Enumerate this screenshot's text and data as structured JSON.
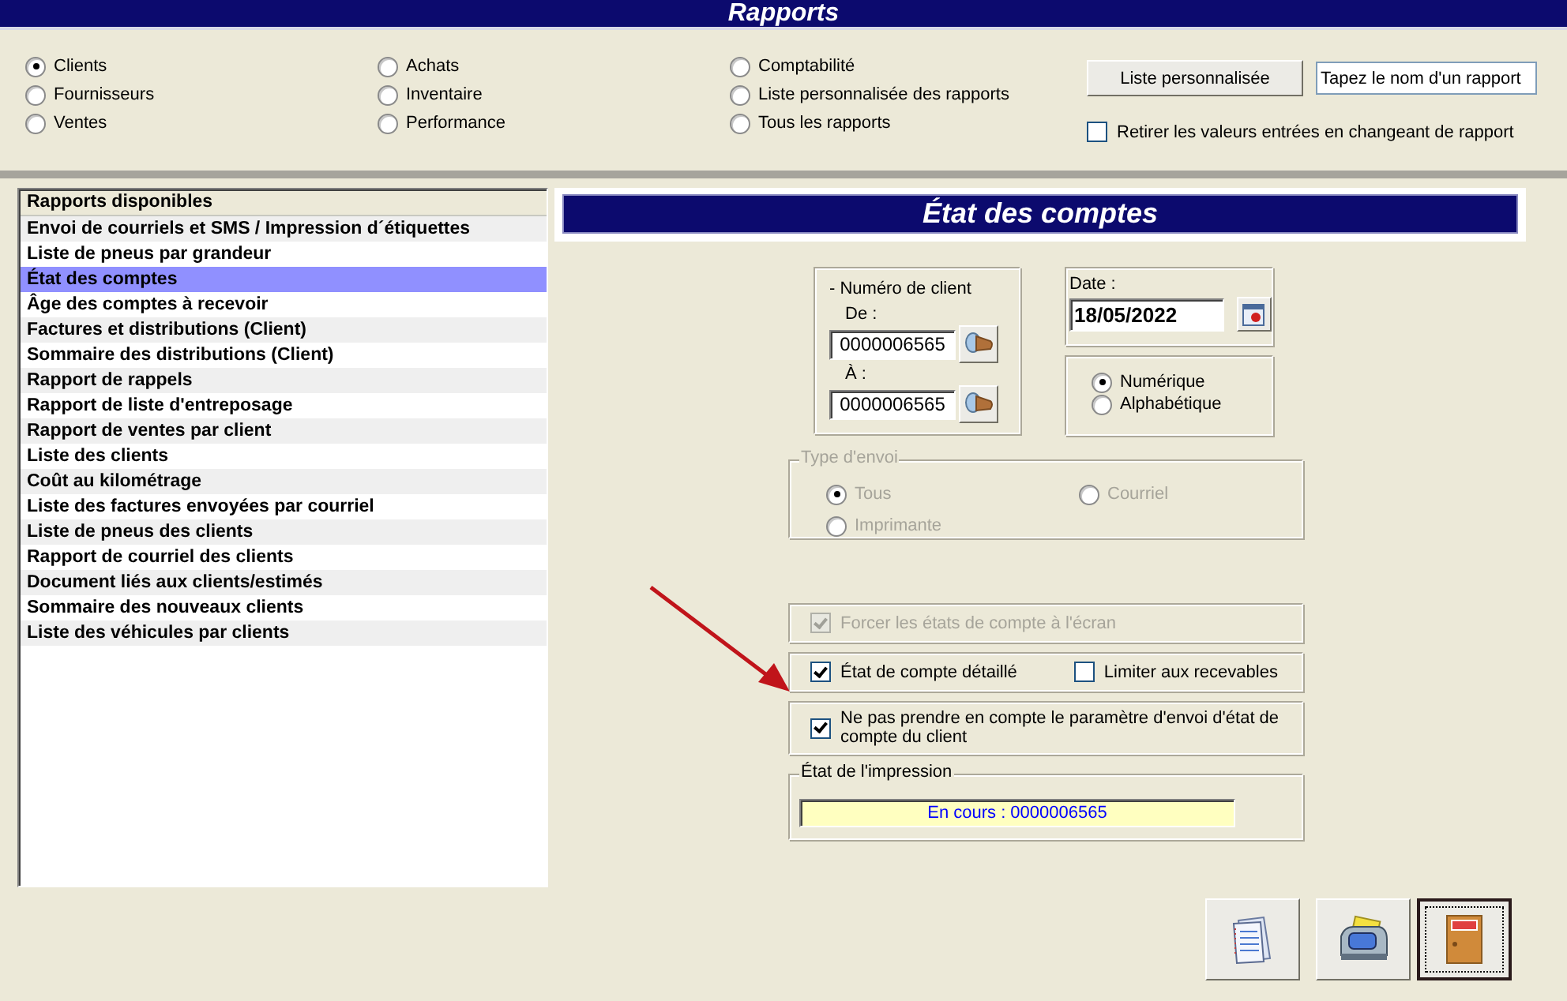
{
  "window": {
    "title": "Rapports"
  },
  "categories": [
    {
      "label": "Clients",
      "selected": true
    },
    {
      "label": "Fournisseurs",
      "selected": false
    },
    {
      "label": "Ventes",
      "selected": false
    },
    {
      "label": "Achats",
      "selected": false
    },
    {
      "label": "Inventaire",
      "selected": false
    },
    {
      "label": "Performance",
      "selected": false
    },
    {
      "label": "Comptabilité",
      "selected": false
    },
    {
      "label": "Liste personnalisée des rapports",
      "selected": false
    },
    {
      "label": "Tous les rapports",
      "selected": false
    }
  ],
  "custom_list_button": "Liste personnalisée",
  "report_search": {
    "placeholder": "Tapez le nom d'un rapport"
  },
  "clear_values": {
    "label": "Retirer les valeurs entrées en changeant de rapport",
    "checked": false
  },
  "reports": {
    "header": "Rapports disponibles",
    "items": [
      {
        "label": "Envoi de courriels et SMS / Impression d´étiquettes",
        "selected": false
      },
      {
        "label": "Liste de pneus par grandeur",
        "selected": false
      },
      {
        "label": "État des comptes",
        "selected": true
      },
      {
        "label": "Âge des comptes à recevoir",
        "selected": false
      },
      {
        "label": "Factures et distributions (Client)",
        "selected": false
      },
      {
        "label": "Sommaire des distributions (Client)",
        "selected": false
      },
      {
        "label": "Rapport de rappels",
        "selected": false
      },
      {
        "label": "Rapport de liste d'entreposage",
        "selected": false
      },
      {
        "label": "Rapport de ventes par client",
        "selected": false
      },
      {
        "label": "Liste des clients",
        "selected": false
      },
      {
        "label": "Coût au kilométrage",
        "selected": false
      },
      {
        "label": "Liste des factures envoyées par courriel",
        "selected": false
      },
      {
        "label": "Liste de pneus des clients",
        "selected": false
      },
      {
        "label": "Rapport de courriel des clients",
        "selected": false
      },
      {
        "label": "Document liés aux clients/estimés",
        "selected": false
      },
      {
        "label": "Sommaire des nouveaux clients",
        "selected": false
      },
      {
        "label": "Liste des véhicules par clients",
        "selected": false
      }
    ]
  },
  "panel": {
    "title": "État des comptes",
    "client_number": {
      "legend": "- Numéro de client",
      "from_label": "De :",
      "from_value": "0000006565",
      "to_label": "À :",
      "to_value": "0000006565"
    },
    "date": {
      "label": "Date :",
      "value": "18/05/2022"
    },
    "sort": [
      {
        "label": "Numérique",
        "selected": true
      },
      {
        "label": "Alphabétique",
        "selected": false
      }
    ],
    "send_type": {
      "legend": "Type d'envoi",
      "disabled": true,
      "options": [
        {
          "label": "Tous",
          "selected": true
        },
        {
          "label": "Courriel",
          "selected": false
        },
        {
          "label": "Imprimante",
          "selected": false
        }
      ]
    },
    "option_groups": [
      {
        "options": [
          {
            "label": "Forcer les états de compte à l'écran",
            "checked": true,
            "disabled": true
          }
        ]
      },
      {
        "options": [
          {
            "label": "État de compte détaillé",
            "checked": true,
            "disabled": false
          },
          {
            "label": "Limiter aux recevables",
            "checked": false,
            "disabled": false
          }
        ]
      },
      {
        "options": [
          {
            "label": "Ne pas prendre en compte le paramètre d'envoi d'état de compte du client",
            "checked": true,
            "disabled": false
          }
        ]
      }
    ],
    "print_status": {
      "legend": "État de l'impression",
      "value": "En cours : 0000006565"
    }
  },
  "actions": [
    {
      "kind": "report",
      "focused": false
    },
    {
      "kind": "print",
      "focused": false
    },
    {
      "kind": "exit",
      "focused": true
    }
  ]
}
